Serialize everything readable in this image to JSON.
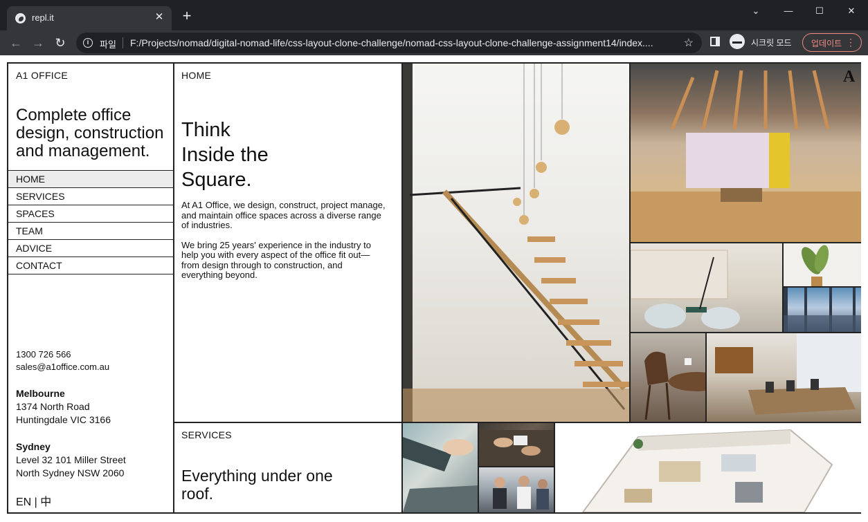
{
  "browser": {
    "tab_title": "repl.it",
    "tab_close": "✕",
    "new_tab": "+",
    "window_controls": {
      "dropdown": "⌄",
      "minimize": "—",
      "maximize": "☐",
      "close": "✕"
    },
    "nav": {
      "back": "←",
      "forward": "→",
      "reload": "↻"
    },
    "scheme_label": "파일",
    "url": "F:/Projects/nomad/digital-nomad-life/css-layout-clone-challenge/nomad-css-layout-clone-challenge-assignment14/index....",
    "star": "☆",
    "incognito_label": "시크릿 모드",
    "update_label": "업데이트",
    "menu": "⋮"
  },
  "site": {
    "brand": "A1 OFFICE",
    "tagline": "Complete office design, construction and management.",
    "nav": [
      {
        "label": "HOME",
        "selected": true
      },
      {
        "label": "SERVICES",
        "selected": false
      },
      {
        "label": "SPACES",
        "selected": false
      },
      {
        "label": "TEAM",
        "selected": false
      },
      {
        "label": "ADVICE",
        "selected": false
      },
      {
        "label": "CONTACT",
        "selected": false
      }
    ],
    "contact": {
      "phone": "1300 726 566",
      "email": "sales@a1office.com.au"
    },
    "offices": [
      {
        "city": "Melbourne",
        "line1": "1374 North Road",
        "line2": "Huntingdale VIC 3166"
      },
      {
        "city": "Sydney",
        "line1": "Level 32 101 Miller Street",
        "line2": "North Sydney NSW 2060"
      }
    ],
    "language": "EN | 中",
    "home": {
      "label": "HOME",
      "headline": [
        "Think",
        "Inside the",
        "Square."
      ],
      "paragraphs": [
        "At A1 Office, we design, construct, project manage, and maintain office spaces across a diverse range of industries.",
        "We bring 25 years' experience in the industry to help you with every aspect of the office fit out—from design through to construction, and everything beyond."
      ]
    },
    "services": {
      "label": "SERVICES",
      "headline": "Everything under one roof."
    },
    "logo_mark": "A"
  }
}
